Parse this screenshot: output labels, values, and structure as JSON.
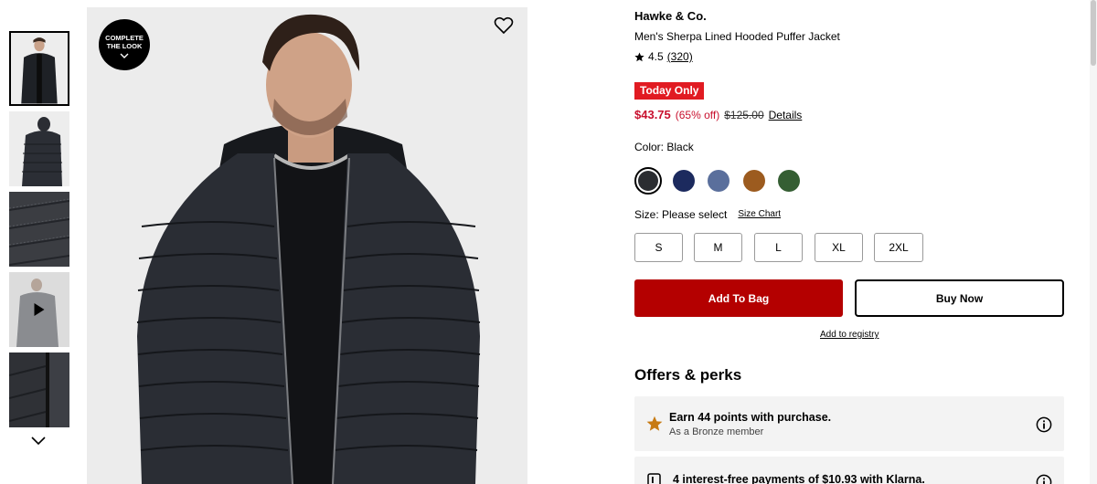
{
  "gallery": {
    "thumbnails": [
      {
        "name": "thumb-front",
        "alt": "jacket front",
        "active": true
      },
      {
        "name": "thumb-back",
        "alt": "jacket back",
        "active": false
      },
      {
        "name": "thumb-detail",
        "alt": "quilted detail",
        "active": false
      },
      {
        "name": "thumb-video",
        "alt": "video",
        "active": false
      },
      {
        "name": "thumb-zipper",
        "alt": "zipper detail",
        "active": false
      }
    ],
    "complete_look_label": "COMPLETE THE LOOK"
  },
  "product": {
    "brand": "Hawke & Co.",
    "name": "Men's Sherpa Lined Hooded Puffer Jacket",
    "rating": "4.5",
    "review_count": "(320)",
    "promo_badge": "Today Only",
    "sale_price": "$43.75",
    "discount": "(65% off)",
    "original_price": "$125.00",
    "details_link": "Details",
    "color_label": "Color: Black",
    "colors": [
      {
        "name": "Black",
        "hex": "#2b2d31",
        "selected": true
      },
      {
        "name": "Navy",
        "hex": "#1c2a5e",
        "selected": false
      },
      {
        "name": "Blue",
        "hex": "#5a6f9c",
        "selected": false
      },
      {
        "name": "Brown",
        "hex": "#9c5b1f",
        "selected": false
      },
      {
        "name": "Green",
        "hex": "#355e33",
        "selected": false
      }
    ],
    "size_label": "Size: Please select",
    "size_chart_link": "Size Chart",
    "sizes": [
      "S",
      "M",
      "L",
      "XL",
      "2XL"
    ],
    "add_to_bag_label": "Add To Bag",
    "buy_now_label": "Buy Now",
    "registry_link": "Add to registry"
  },
  "offers": {
    "title": "Offers & perks",
    "perks": [
      {
        "title": "Earn 44 points with purchase.",
        "subtitle": "As a Bronze member",
        "icon": "star-icon"
      },
      {
        "title": "4 interest-free payments of $10.93 with Klarna.",
        "subtitle": "",
        "icon": "klarna-icon"
      }
    ]
  },
  "colors": {
    "accent_red": "#e11b22",
    "button_red": "#b40000",
    "sale_red": "#c8102e",
    "star_gold": "#c77a12"
  }
}
